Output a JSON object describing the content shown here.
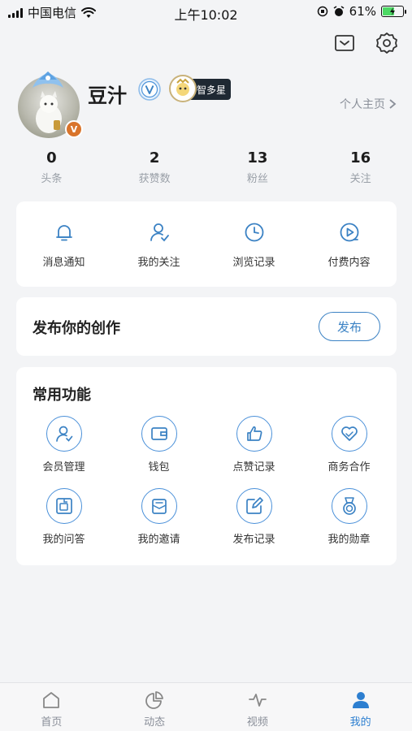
{
  "status_bar": {
    "carrier": "中国电信",
    "time": "上午10:02",
    "battery": "61%",
    "battery_level": 0.61
  },
  "profile": {
    "username": "豆汁",
    "avatar_badge": "V",
    "title_badge": "智多星",
    "home_link": "个人主页"
  },
  "stats": [
    {
      "value": "0",
      "label": "头条"
    },
    {
      "value": "2",
      "label": "获赞数"
    },
    {
      "value": "13",
      "label": "粉丝"
    },
    {
      "value": "16",
      "label": "关注"
    }
  ],
  "quick_actions": [
    {
      "label": "消息通知",
      "icon": "bell-icon"
    },
    {
      "label": "我的关注",
      "icon": "user-check-icon"
    },
    {
      "label": "浏览记录",
      "icon": "clock-icon"
    },
    {
      "label": "付费内容",
      "icon": "play-circle-icon"
    }
  ],
  "publish": {
    "title": "发布你的创作",
    "button": "发布"
  },
  "functions": {
    "title": "常用功能",
    "items": [
      {
        "label": "会员管理",
        "icon": "member-icon"
      },
      {
        "label": "钱包",
        "icon": "wallet-icon"
      },
      {
        "label": "点赞记录",
        "icon": "thumbs-up-icon"
      },
      {
        "label": "商务合作",
        "icon": "handshake-heart-icon"
      },
      {
        "label": "我的问答",
        "icon": "qa-icon"
      },
      {
        "label": "我的邀请",
        "icon": "invite-icon"
      },
      {
        "label": "发布记录",
        "icon": "edit-icon"
      },
      {
        "label": "我的勋章",
        "icon": "medal-icon"
      }
    ]
  },
  "tabbar": [
    {
      "label": "首页",
      "icon": "home-icon",
      "active": false
    },
    {
      "label": "动态",
      "icon": "pie-icon",
      "active": false
    },
    {
      "label": "视频",
      "icon": "video-icon",
      "active": false
    },
    {
      "label": "我的",
      "icon": "user-icon",
      "active": true
    }
  ],
  "colors": {
    "accent": "#2d7fd0",
    "background": "#f3f4f6",
    "card": "#ffffff"
  }
}
